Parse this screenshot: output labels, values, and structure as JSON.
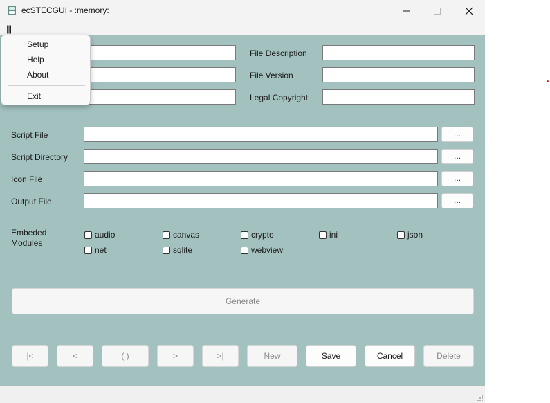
{
  "window": {
    "title": "ecSTECGUI - :memory:",
    "menu_toggle": "|||"
  },
  "fields": {
    "file_description": {
      "label": "File Description",
      "value": ""
    },
    "file_version": {
      "label": "File Version",
      "value": ""
    },
    "legal_copyright": {
      "label": "Legal Copyright",
      "value": ""
    },
    "left_field_1": {
      "value": ""
    },
    "left_field_2": {
      "value": ""
    },
    "left_field_3": {
      "value": ""
    }
  },
  "files": [
    {
      "label": "Script File",
      "value": "",
      "browse": "..."
    },
    {
      "label": "Script Directory",
      "value": "",
      "browse": "..."
    },
    {
      "label": "Icon File",
      "value": "",
      "browse": "..."
    },
    {
      "label": "Output File",
      "value": "",
      "browse": "..."
    }
  ],
  "modules": {
    "label_line1": "Embeded",
    "label_line2": "Modules",
    "items": [
      {
        "name": "audio",
        "checked": false
      },
      {
        "name": "canvas",
        "checked": false
      },
      {
        "name": "crypto",
        "checked": false
      },
      {
        "name": "ini",
        "checked": false
      },
      {
        "name": "json",
        "checked": false
      },
      {
        "name": "net",
        "checked": false
      },
      {
        "name": "sqlite",
        "checked": false
      },
      {
        "name": "webview",
        "checked": false
      }
    ]
  },
  "generate_label": "Generate",
  "nav": {
    "first": "|<",
    "prev": "<",
    "current": "( )",
    "next": ">",
    "last": ">|",
    "new": "New",
    "save": "Save",
    "cancel": "Cancel",
    "delete": "Delete"
  },
  "popup_menu": {
    "setup": "Setup",
    "help": "Help",
    "about": "About",
    "exit": "Exit"
  },
  "colors": {
    "client_background": "#a2c1bf",
    "titlebar": "#f3f3f3",
    "disabled_text": "#8a8a8a"
  }
}
